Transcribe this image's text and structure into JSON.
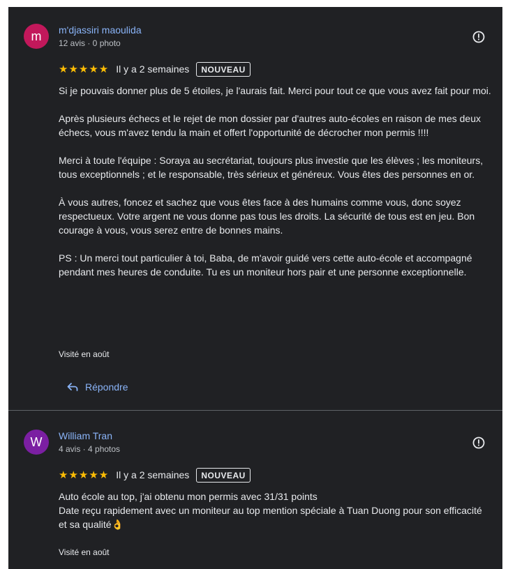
{
  "reviews": [
    {
      "avatar_letter": "m",
      "avatar_color": "#c2185b",
      "author": "m'djassiri maoulida",
      "meta": "12 avis · 0 photo",
      "stars": "★★★★★",
      "time": "Il y a 2 semaines",
      "badge": "NOUVEAU",
      "paragraphs": [
        "Si je pouvais donner plus de 5 étoiles, je l'aurais fait. Merci pour tout ce que vous avez fait pour moi.",
        "Après plusieurs échecs et le rejet de mon dossier par d'autres auto-écoles en raison de mes deux échecs, vous m'avez tendu la main et offert l'opportunité de décrocher mon permis !!!!",
        "Merci à toute l'équipe : Soraya au secrétariat, toujours plus investie que les élèves ; les moniteurs, tous exceptionnels ; et le responsable, très sérieux et généreux. Vous êtes des personnes en or.",
        "À vous autres, foncez et sachez que vous êtes face à des humains comme vous, donc soyez respectueux. Votre argent ne vous donne pas tous les droits. La sécurité de tous est en jeu. Bon courage à vous, vous serez entre de bonnes mains.",
        "PS : Un merci tout particulier à toi, Baba, de m'avoir guidé vers cette auto-école et accompagné pendant mes heures de conduite. Tu es un moniteur hors pair et une personne exceptionnelle."
      ],
      "visited": "Visité en août",
      "reply": "Répondre"
    },
    {
      "avatar_letter": "W",
      "avatar_color": "#7b1fa2",
      "author": "William Tran",
      "meta": "4 avis · 4 photos",
      "stars": "★★★★★",
      "time": "Il y a 2 semaines",
      "badge": "NOUVEAU",
      "lines": [
        "Auto école au top, j'ai obtenu mon permis avec 31/31 points",
        "Date reçu rapidement avec un moniteur au top mention spéciale à Tuan Duong pour son efficacité et sa qualité👌"
      ],
      "visited": "Visité en août"
    }
  ],
  "colors": {
    "background": "#202124",
    "text": "#e8eaed",
    "link": "#8ab4f8",
    "star": "#fbbc04",
    "divider": "#5f6368"
  },
  "icons": {
    "report": "report-icon",
    "reply": "reply-arrow-icon"
  }
}
